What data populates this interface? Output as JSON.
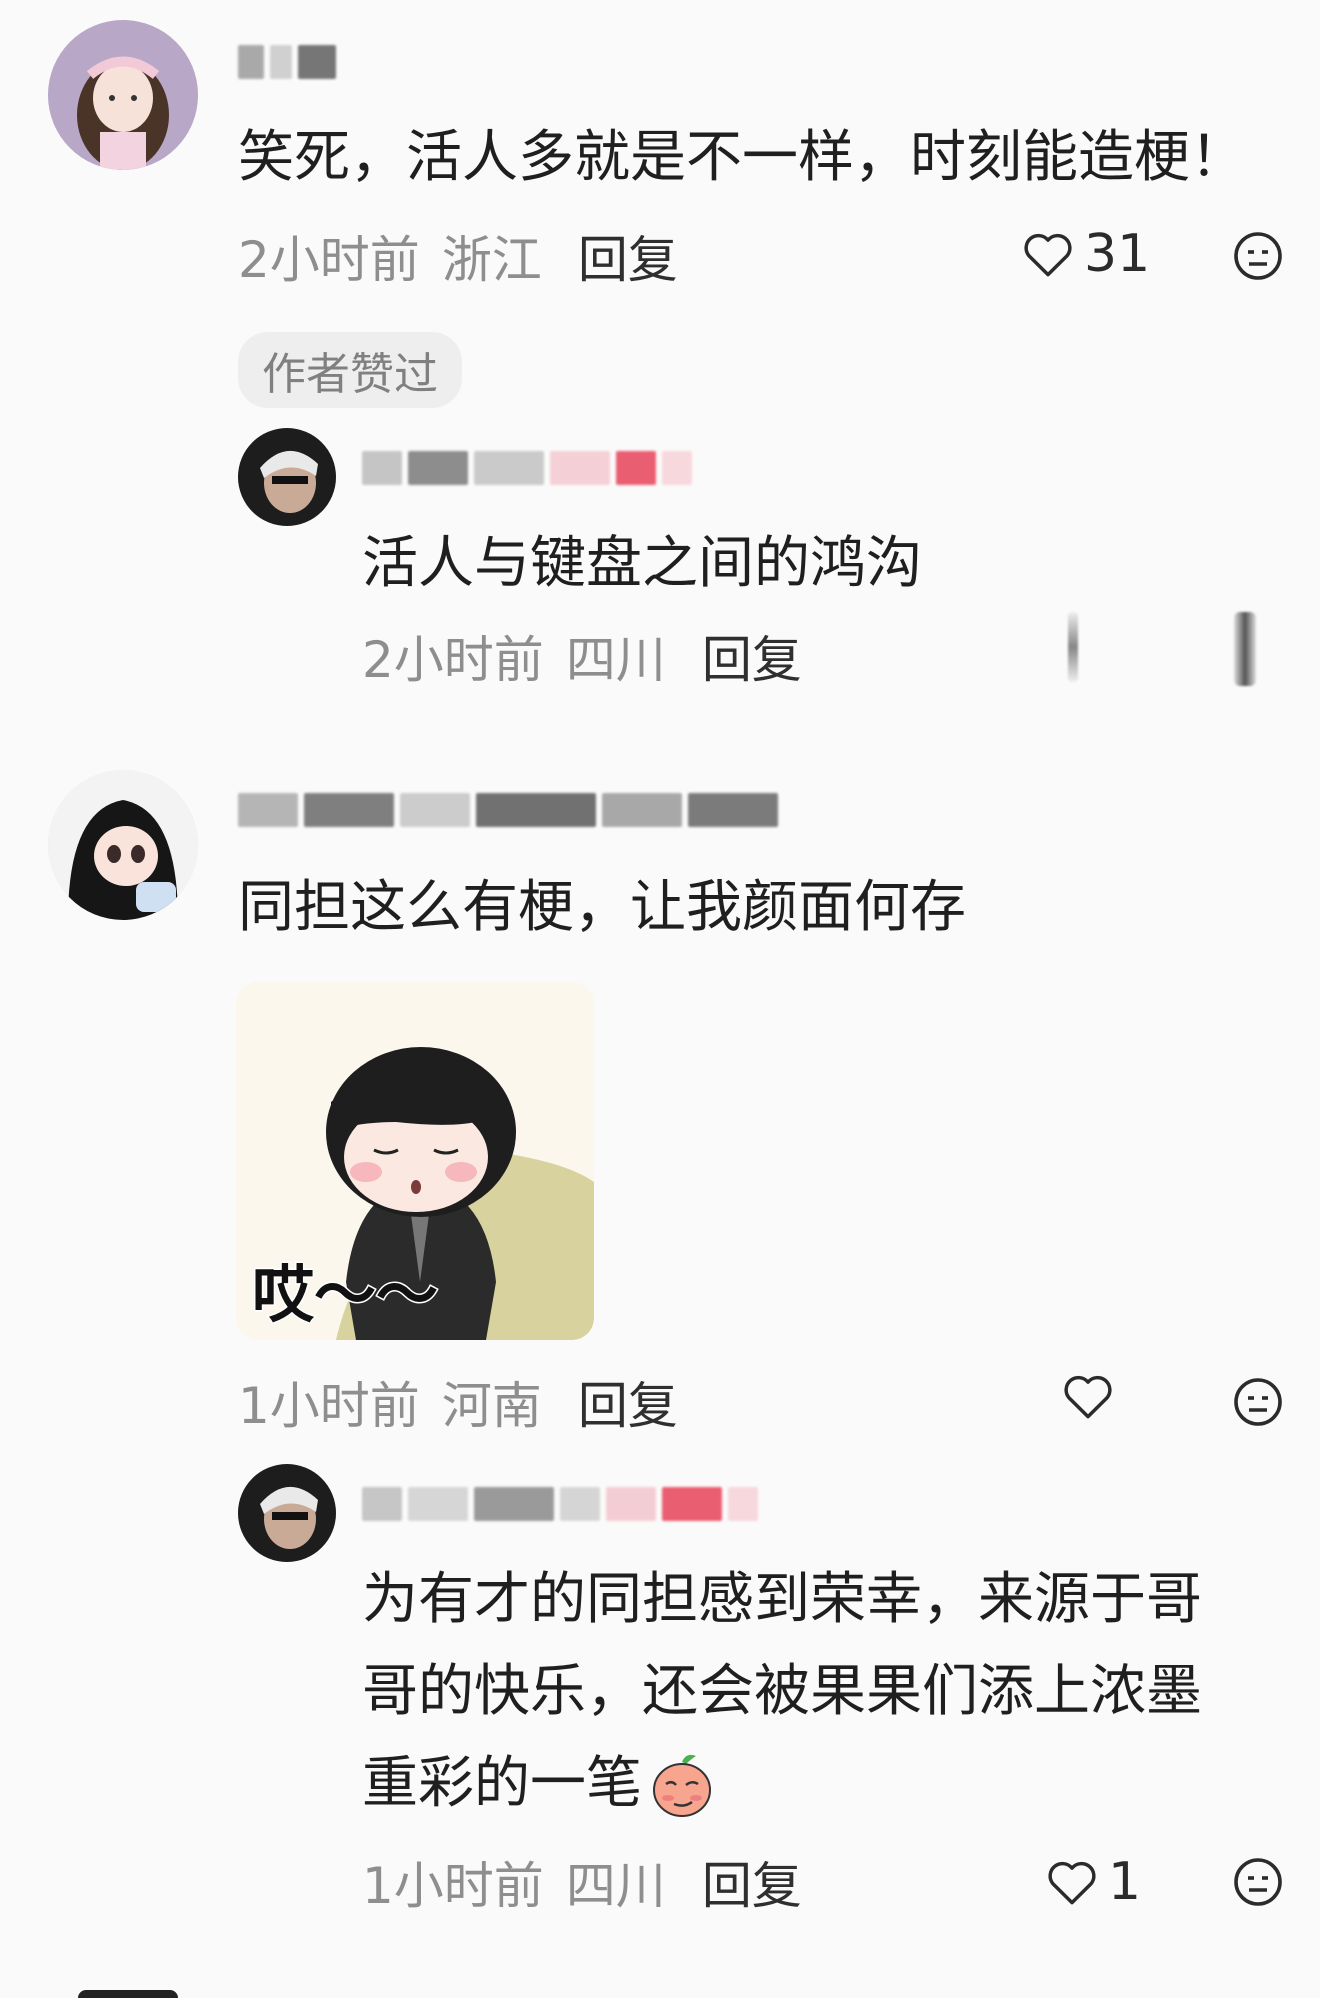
{
  "comments": [
    {
      "text": "笑死，活人多就是不一样，时刻能造梗！",
      "time": "2小时前",
      "location": "浙江",
      "reply_label": "回复",
      "likes": "31",
      "badge": "作者赞过",
      "replies": [
        {
          "text": "活人与键盘之间的鸿沟",
          "time": "2小时前",
          "location": "四川",
          "reply_label": "回复"
        }
      ]
    },
    {
      "text": "同担这么有梗，让我颜面何存",
      "time": "1小时前",
      "location": "河南",
      "reply_label": "回复",
      "sticker_text": "哎～～",
      "replies": [
        {
          "lines": [
            "为有才的同担感到荣幸，来源于哥",
            "哥的快乐，还会被果果们添上浓墨",
            "重彩的一笔"
          ],
          "time": "1小时前",
          "location": "四川",
          "reply_label": "回复",
          "likes": "1"
        }
      ]
    }
  ],
  "icons": {
    "like": "heart-outline-icon",
    "dislike": "neutral-face-icon",
    "emoji": "peach-smirk-emoji"
  },
  "colors": {
    "meta_gray": "#8e8e8e",
    "text": "#1f1f1f",
    "pill_bg": "#eeeeee",
    "blur_red": "#e8435a"
  }
}
